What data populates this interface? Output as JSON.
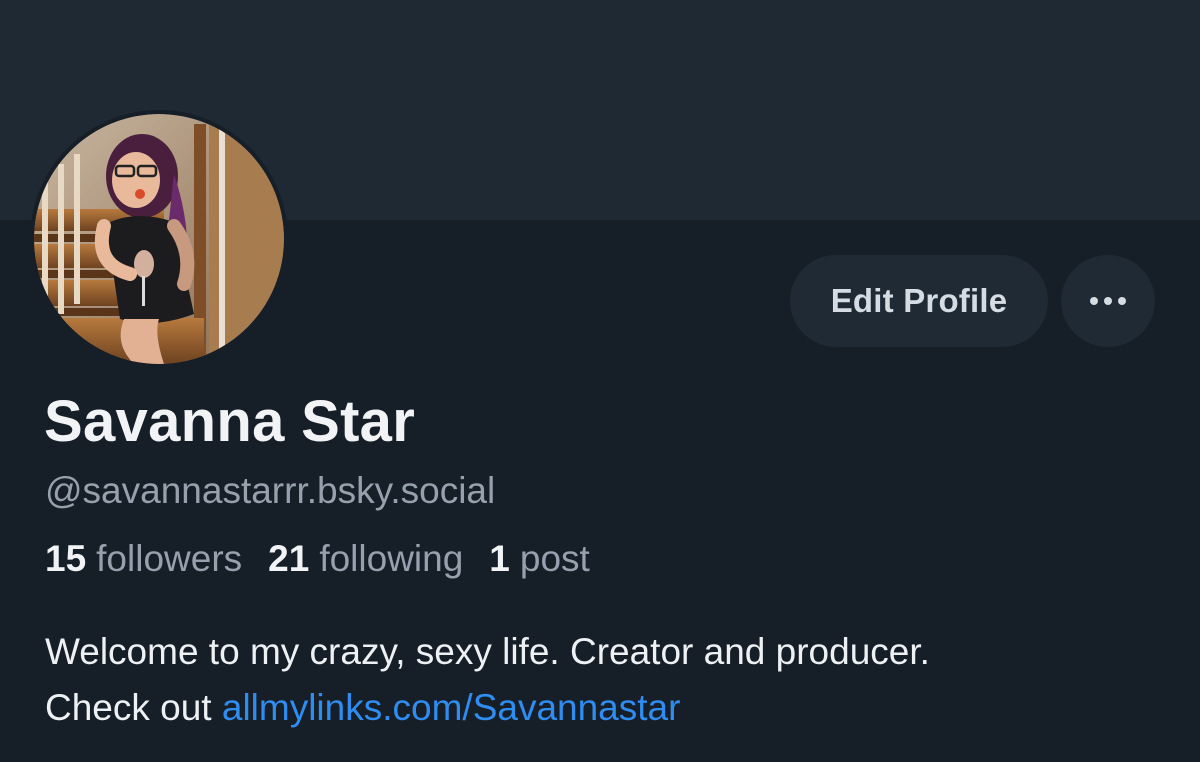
{
  "profile": {
    "display_name": "Savanna Star",
    "handle": "@savannastarrr.bsky.social",
    "stats": {
      "followers_count": "15",
      "followers_label": "followers",
      "following_count": "21",
      "following_label": "following",
      "posts_count": "1",
      "posts_label": "post"
    },
    "bio": {
      "line1": "Welcome to my crazy, sexy life. Creator and producer.",
      "line2_prefix": "Check out ",
      "link_text": "allmylinks.com/Savannastar"
    }
  },
  "actions": {
    "edit_profile_label": "Edit Profile",
    "more_icon": "ellipsis-icon"
  },
  "colors": {
    "background": "#161e27",
    "banner": "#1f2933",
    "button_bg": "#1f2a34",
    "link": "#2f8cf0",
    "muted_text": "#96a1ad"
  }
}
